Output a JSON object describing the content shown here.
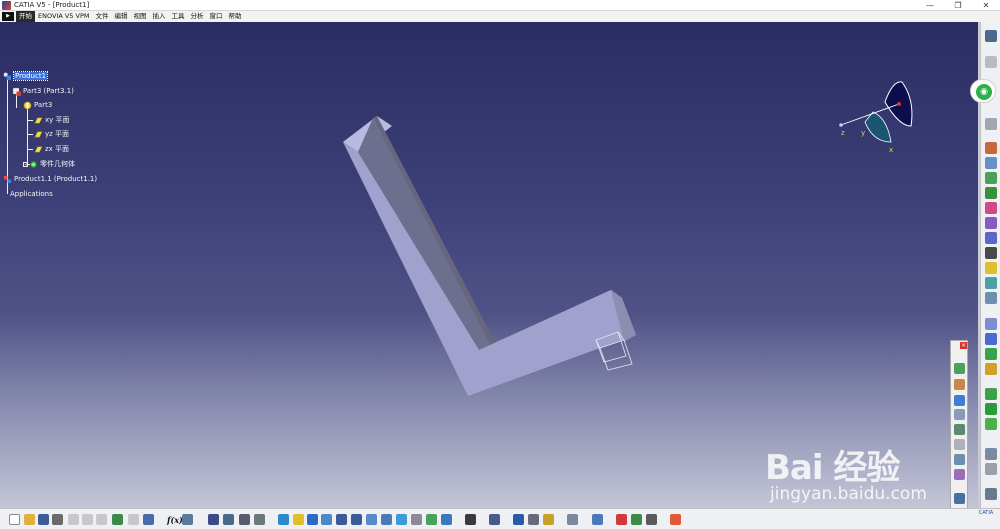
{
  "window": {
    "title": "CATIA V5 - [Product1]",
    "minimize": "—",
    "maximize": "❐",
    "close": "✕"
  },
  "menu": {
    "items": [
      "开始",
      "ENOVIA V5 VPM",
      "文件",
      "编辑",
      "视图",
      "插入",
      "工具",
      "分析",
      "窗口",
      "帮助"
    ]
  },
  "tree": {
    "product": "Product1",
    "part_instance": "Part3 (Part3.1)",
    "part": "Part3",
    "plane_xy": "xy 平面",
    "plane_yz": "yz 平面",
    "plane_zx": "zx 平面",
    "body": "零件几何体",
    "sub_product": "Product1.1 (Product1.1)",
    "applications": "Applications"
  },
  "compass": {
    "axis_x": "x",
    "axis_y": "y",
    "axis_z": "z"
  },
  "toolbar": {
    "fx_label": "f(x)"
  },
  "float_toolbar": {
    "close": "×"
  },
  "watermark": {
    "logo_text": "Bai 经验",
    "url": "jingyan.baidu.com"
  },
  "corner": {
    "brand": "CATIA"
  },
  "colors": {
    "viewport_top": "#2b2c62",
    "viewport_bottom": "#c4c6d7",
    "part_light": "#b6b7e0",
    "part_mid": "#9b9cc8",
    "part_dark": "#6d6e8e",
    "selection": "#3a6ed8",
    "compass_fill": "#0c0d4c"
  }
}
